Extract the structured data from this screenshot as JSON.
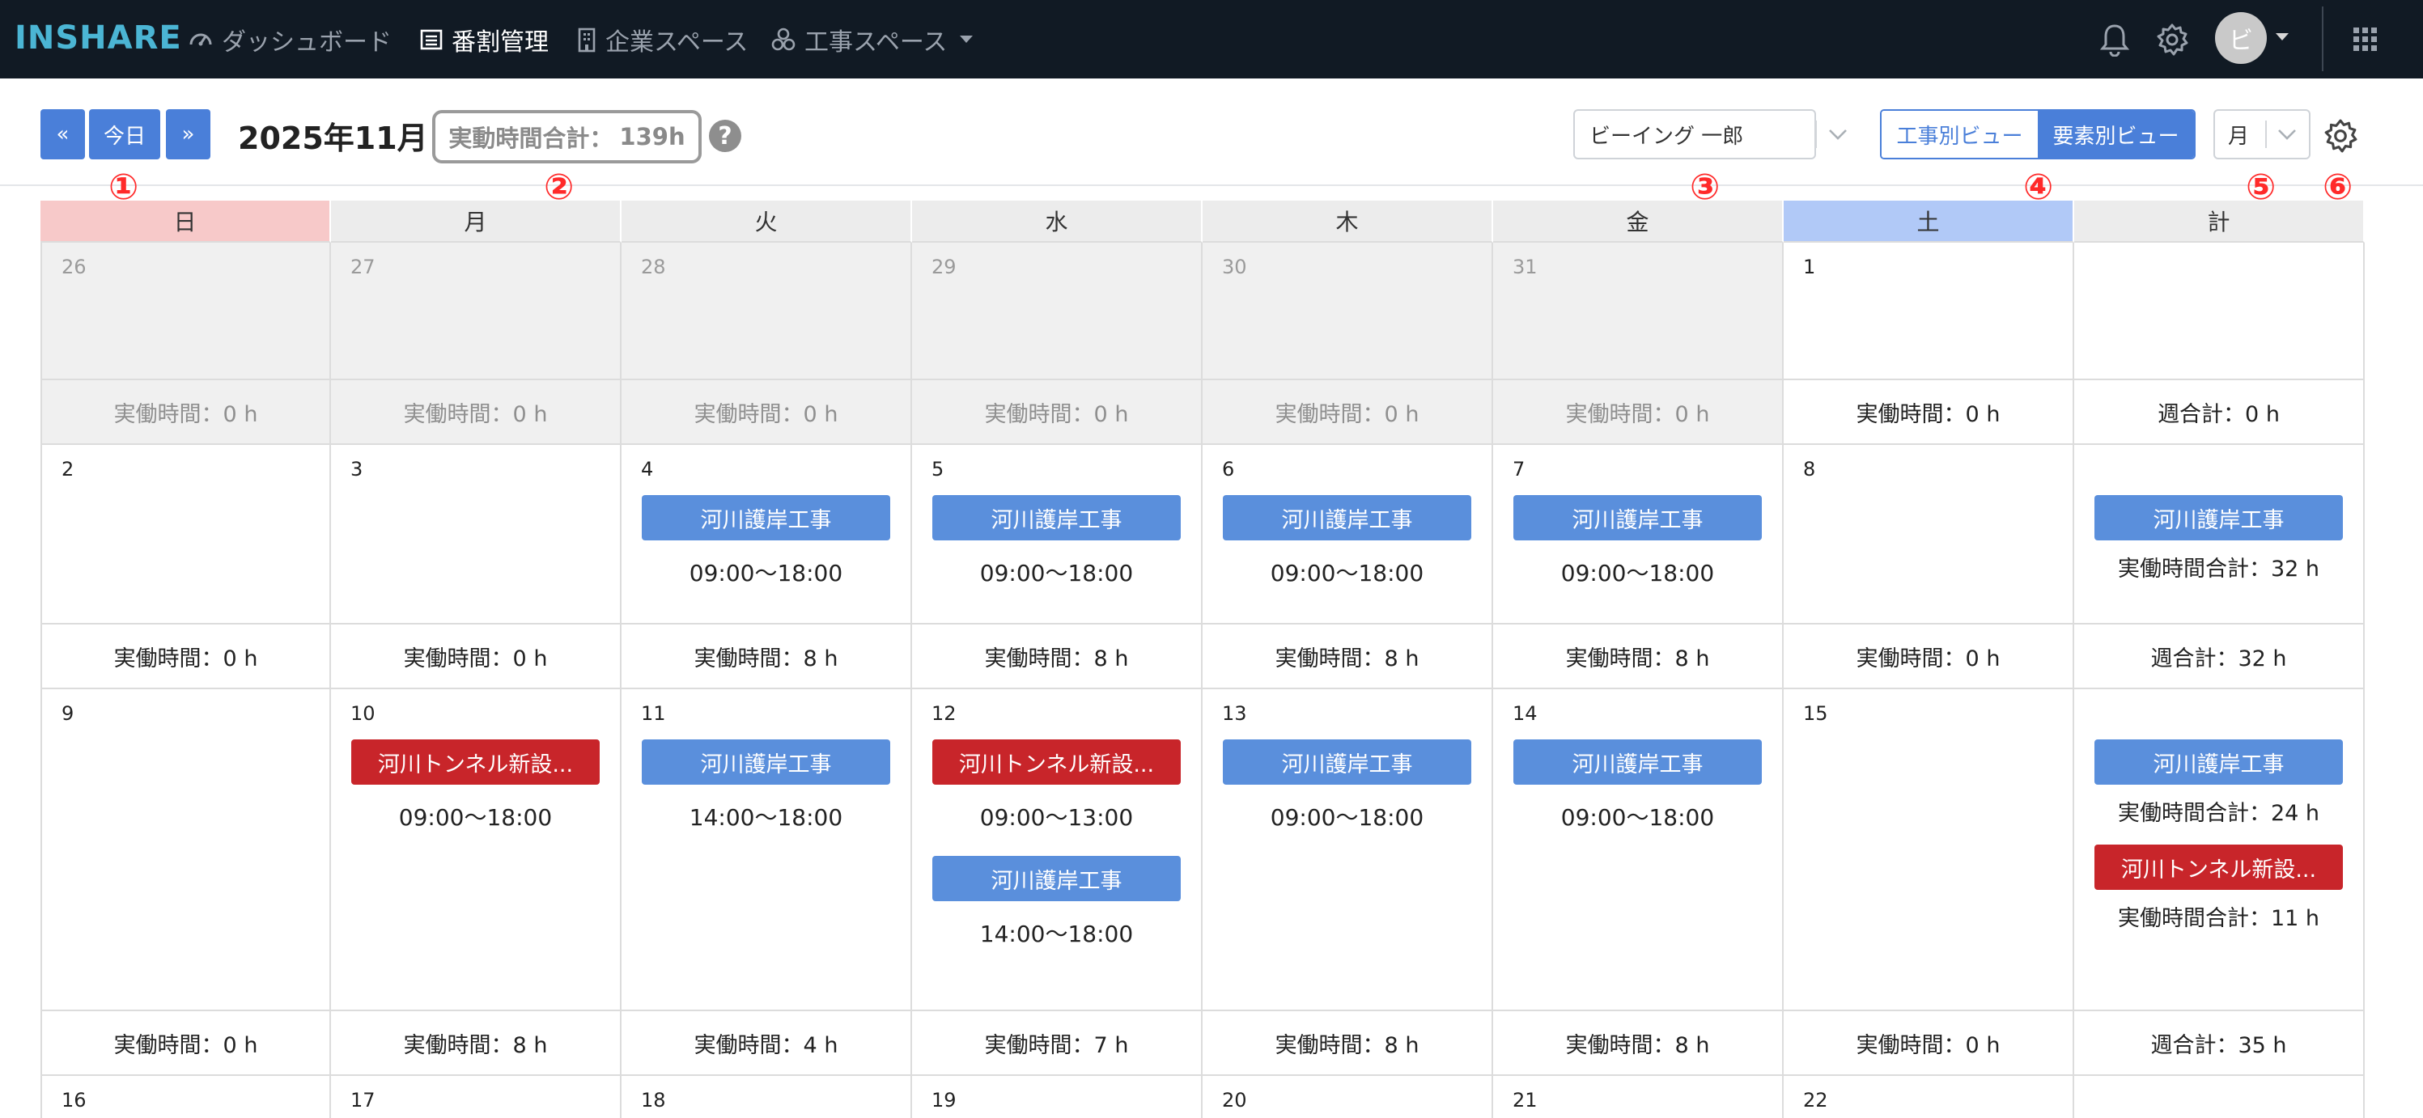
{
  "nav": {
    "logo": "INSHARE",
    "items": [
      {
        "label": "ダッシュボード",
        "icon": "dashboard-icon",
        "active": false
      },
      {
        "label": "番割管理",
        "icon": "list-icon",
        "active": true
      },
      {
        "label": "企業スペース",
        "icon": "building-icon",
        "active": false
      },
      {
        "label": "工事スペース",
        "icon": "cluster-icon",
        "active": false,
        "dropdown": true
      }
    ],
    "avatar_initial": "ビ"
  },
  "toolbar": {
    "prev_label": "«",
    "today_label": "今日",
    "next_label": "»",
    "month_title": "2025年11月",
    "total_label": "実動時間合計：",
    "total_value": "139h",
    "help_symbol": "?",
    "user_select_value": "ビーイング 一郎",
    "view_toggle": [
      {
        "label": "工事別ビュー",
        "selected": false
      },
      {
        "label": "要素別ビュー",
        "selected": true
      }
    ],
    "period_select_value": "月"
  },
  "markers": [
    "①",
    "②",
    "③",
    "④",
    "⑤",
    "⑥"
  ],
  "colors": {
    "nav_bg": "#111a24",
    "logo": "#4bb5d4",
    "primary": "#4a7fd9",
    "event_blue": "#5a8fdc",
    "event_red": "#c8252a",
    "sunday_header": "#f7c9c9",
    "saturday_header": "#b1c9f7",
    "marker": "#ff2a2a"
  },
  "calendar": {
    "headers": [
      "日",
      "月",
      "火",
      "水",
      "木",
      "金",
      "土",
      "計"
    ],
    "weeks": [
      {
        "days": [
          {
            "num": "26",
            "muted": true,
            "events": [],
            "summary": "実働時間：0 h"
          },
          {
            "num": "27",
            "muted": true,
            "events": [],
            "summary": "実働時間：0 h"
          },
          {
            "num": "28",
            "muted": true,
            "events": [],
            "summary": "実働時間：0 h"
          },
          {
            "num": "29",
            "muted": true,
            "events": [],
            "summary": "実働時間：0 h"
          },
          {
            "num": "30",
            "muted": true,
            "events": [],
            "summary": "実働時間：0 h"
          },
          {
            "num": "31",
            "muted": true,
            "events": [],
            "summary": "実働時間：0 h"
          },
          {
            "num": "1",
            "muted": false,
            "events": [],
            "summary": "実働時間：0 h"
          }
        ],
        "total": {
          "entries": [],
          "summary": "週合計：0 h"
        }
      },
      {
        "days": [
          {
            "num": "2",
            "muted": false,
            "events": [],
            "summary": "実働時間：0 h"
          },
          {
            "num": "3",
            "muted": false,
            "events": [],
            "summary": "実働時間：0 h"
          },
          {
            "num": "4",
            "muted": false,
            "events": [
              {
                "label": "河川護岸工事",
                "color": "blue",
                "time": "09:00〜18:00"
              }
            ],
            "summary": "実働時間：8 h"
          },
          {
            "num": "5",
            "muted": false,
            "events": [
              {
                "label": "河川護岸工事",
                "color": "blue",
                "time": "09:00〜18:00"
              }
            ],
            "summary": "実働時間：8 h"
          },
          {
            "num": "6",
            "muted": false,
            "events": [
              {
                "label": "河川護岸工事",
                "color": "blue",
                "time": "09:00〜18:00"
              }
            ],
            "summary": "実働時間：8 h"
          },
          {
            "num": "7",
            "muted": false,
            "events": [
              {
                "label": "河川護岸工事",
                "color": "blue",
                "time": "09:00〜18:00"
              }
            ],
            "summary": "実働時間：8 h"
          },
          {
            "num": "8",
            "muted": false,
            "events": [],
            "summary": "実働時間：0 h"
          }
        ],
        "total": {
          "entries": [
            {
              "label": "河川護岸工事",
              "color": "blue",
              "total": "実働時間合計：32 h"
            }
          ],
          "summary": "週合計：32 h"
        }
      },
      {
        "days": [
          {
            "num": "9",
            "muted": false,
            "events": [],
            "summary": "実働時間：0 h"
          },
          {
            "num": "10",
            "muted": false,
            "events": [
              {
                "label": "河川トンネル新設...",
                "color": "red",
                "time": "09:00〜18:00"
              }
            ],
            "summary": "実働時間：8 h"
          },
          {
            "num": "11",
            "muted": false,
            "events": [
              {
                "label": "河川護岸工事",
                "color": "blue",
                "time": "14:00〜18:00"
              }
            ],
            "summary": "実働時間：4 h"
          },
          {
            "num": "12",
            "muted": false,
            "events": [
              {
                "label": "河川トンネル新設...",
                "color": "red",
                "time": "09:00〜13:00"
              },
              {
                "label": "河川護岸工事",
                "color": "blue",
                "time": "14:00〜18:00"
              }
            ],
            "summary": "実働時間：7 h"
          },
          {
            "num": "13",
            "muted": false,
            "events": [
              {
                "label": "河川護岸工事",
                "color": "blue",
                "time": "09:00〜18:00"
              }
            ],
            "summary": "実働時間：8 h"
          },
          {
            "num": "14",
            "muted": false,
            "events": [
              {
                "label": "河川護岸工事",
                "color": "blue",
                "time": "09:00〜18:00"
              }
            ],
            "summary": "実働時間：8 h"
          },
          {
            "num": "15",
            "muted": false,
            "events": [],
            "summary": "実働時間：0 h"
          }
        ],
        "total": {
          "entries": [
            {
              "label": "河川護岸工事",
              "color": "blue",
              "total": "実働時間合計：24 h"
            },
            {
              "label": "河川トンネル新設...",
              "color": "red",
              "total": "実働時間合計：11 h"
            }
          ],
          "summary": "週合計：35 h"
        }
      },
      {
        "days": [
          {
            "num": "16",
            "muted": false,
            "events": []
          },
          {
            "num": "17",
            "muted": false,
            "events": []
          },
          {
            "num": "18",
            "muted": false,
            "events": []
          },
          {
            "num": "19",
            "muted": false,
            "events": []
          },
          {
            "num": "20",
            "muted": false,
            "events": []
          },
          {
            "num": "21",
            "muted": false,
            "events": []
          },
          {
            "num": "22",
            "muted": false,
            "events": []
          }
        ],
        "total": {
          "entries": []
        }
      }
    ]
  }
}
